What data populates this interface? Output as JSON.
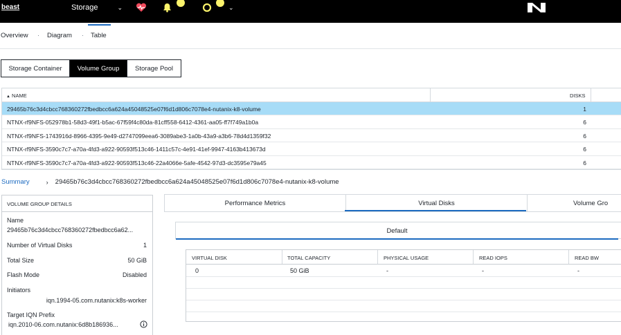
{
  "topbar": {
    "logo": "beast",
    "entity": "Storage",
    "entity_chevron": "chevron-down-icon",
    "icons": [
      "heart-pulse-icon",
      "bell-icon",
      "status-circle-icon"
    ],
    "brand_icon": "nutanix-n-icon",
    "colors": {
      "bar": "#000000",
      "badge": "#fbf36b",
      "heart": "#f04a5c"
    }
  },
  "subnav": {
    "tabs": [
      "Overview",
      "Diagram",
      "Table"
    ],
    "active": "Table",
    "separator": "·"
  },
  "segments": {
    "items": [
      "Storage Container",
      "Volume Group",
      "Storage Pool"
    ],
    "active": "Volume Group"
  },
  "table": {
    "headers": {
      "name": "NAME",
      "disks": "DISKS"
    },
    "sort_icon": "sort-ascending-icon",
    "rows": [
      {
        "name": "29465b76c3d4cbcc768360272fbedbcc6a624a45048525e07f6d1d806c7078e4-nutanix-k8-volume",
        "disks": "1",
        "selected": true
      },
      {
        "name": "NTNX-rf9NFS-052978b1-58d3-49f1-b5ac-67f59f4c80da-81cff558-6412-4361-aa05-ff7f749a1b0a",
        "disks": "6"
      },
      {
        "name": "NTNX-rf9NFS-1743916d-8966-4395-9e49-d2747099eea6-3089abe3-1a0b-43a9-a3b6-78d4d1359f32",
        "disks": "6"
      },
      {
        "name": "NTNX-rf9NFS-3590c7c7-a70a-4fd3-a922-90593f513c46-1411c57c-4e91-41ef-9947-4163b413673d",
        "disks": "6"
      },
      {
        "name": "NTNX-rf9NFS-3590c7c7-a70a-4fd3-a922-90593f513c46-22a4066e-5afe-4542-97d3-dc3595e79a45",
        "disks": "6"
      }
    ]
  },
  "breadcrumb": {
    "root": "Summary",
    "arrow": "›",
    "current": "29465b76c3d4cbcc768360272fbedbcc6a624a45048525e07f6d1d806c7078e4-nutanix-k8-volume"
  },
  "details": {
    "header": "VOLUME GROUP DETAILS",
    "name_label": "Name",
    "name_value": "29465b76c3d4cbcc768360272fbedbcc6a62...",
    "vdisks_label": "Number of Virtual Disks",
    "vdisks_value": "1",
    "size_label": "Total Size",
    "size_value": "50 GiB",
    "flash_label": "Flash Mode",
    "flash_value": "Disabled",
    "initiators_label": "Initiators",
    "initiators_value": "iqn.1994-05.com.nutanix:k8s-worker",
    "iqn_label": "Target IQN Prefix",
    "iqn_value": "iqn.2010-06.com.nutanix:6d8b186936...",
    "info_icon": "info-icon"
  },
  "right_tabs": {
    "items": [
      "Performance Metrics",
      "Virtual Disks",
      "Volume Gro"
    ],
    "active": "Virtual Disks"
  },
  "subtab": {
    "label": "Default"
  },
  "vdisk_table": {
    "headers": [
      "VIRTUAL DISK",
      "TOTAL CAPACITY",
      "PHYSICAL USAGE",
      "READ IOPS",
      "READ BW"
    ],
    "rows": [
      [
        "0",
        "50 GiB",
        "-",
        "-",
        "-"
      ]
    ]
  }
}
